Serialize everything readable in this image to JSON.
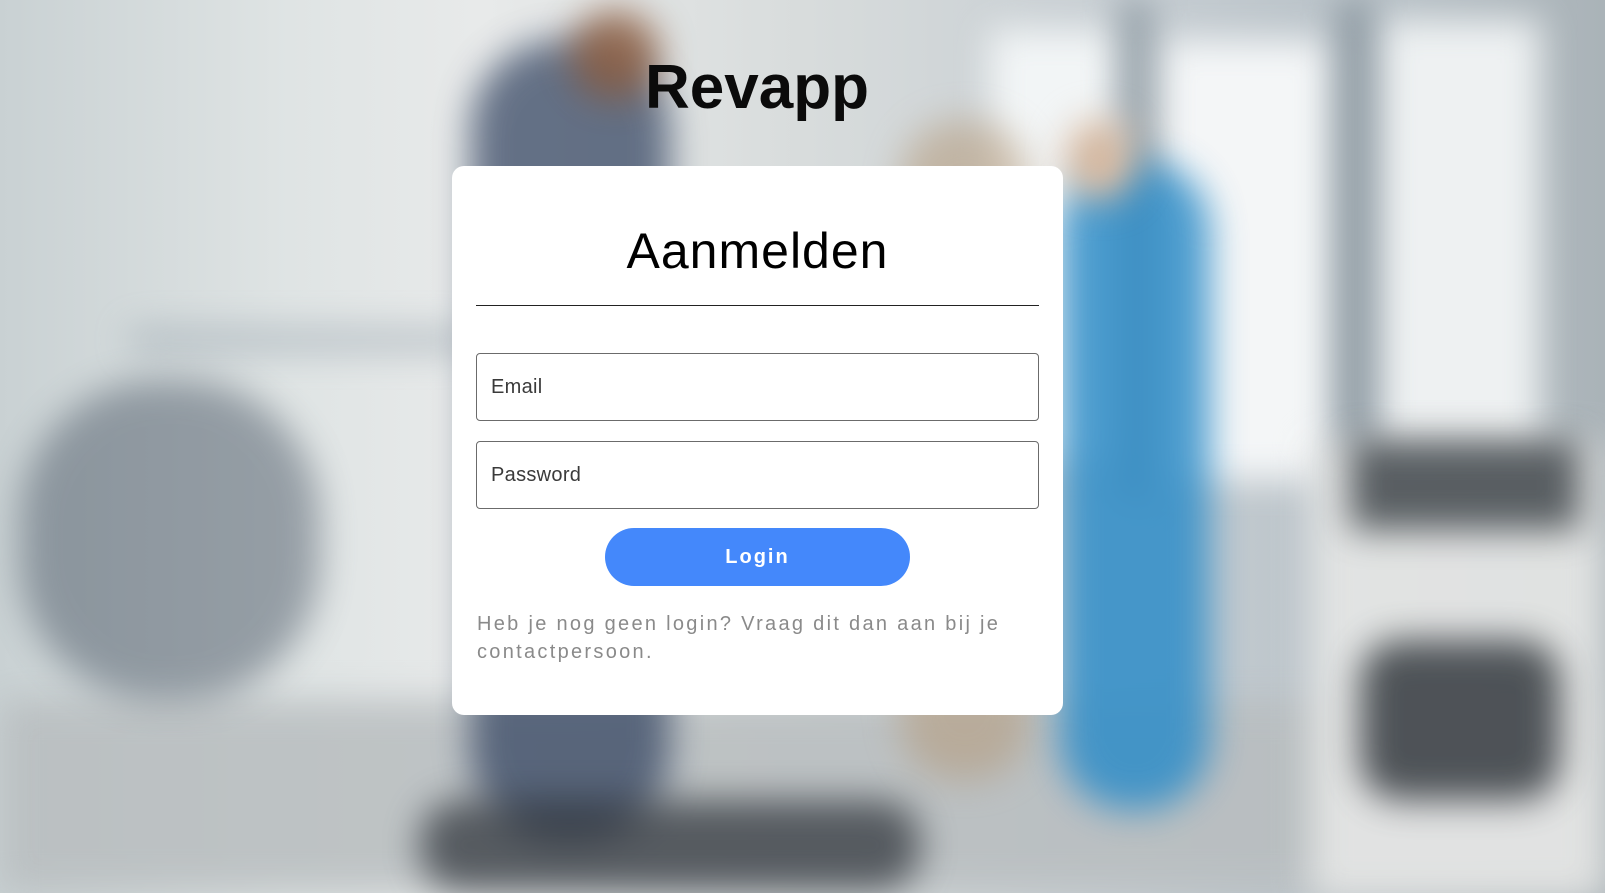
{
  "app": {
    "title": "Revapp"
  },
  "login_card": {
    "heading": "Aanmelden",
    "email": {
      "placeholder": "Email",
      "value": ""
    },
    "password": {
      "placeholder": "Password",
      "value": ""
    },
    "login_button_label": "Login",
    "help_text": "Heb je nog geen login? Vraag dit dan aan bij je contactpersoon."
  },
  "colors": {
    "accent": "#4488fb",
    "card_background": "#ffffff",
    "help_text": "#8a8a8a"
  }
}
